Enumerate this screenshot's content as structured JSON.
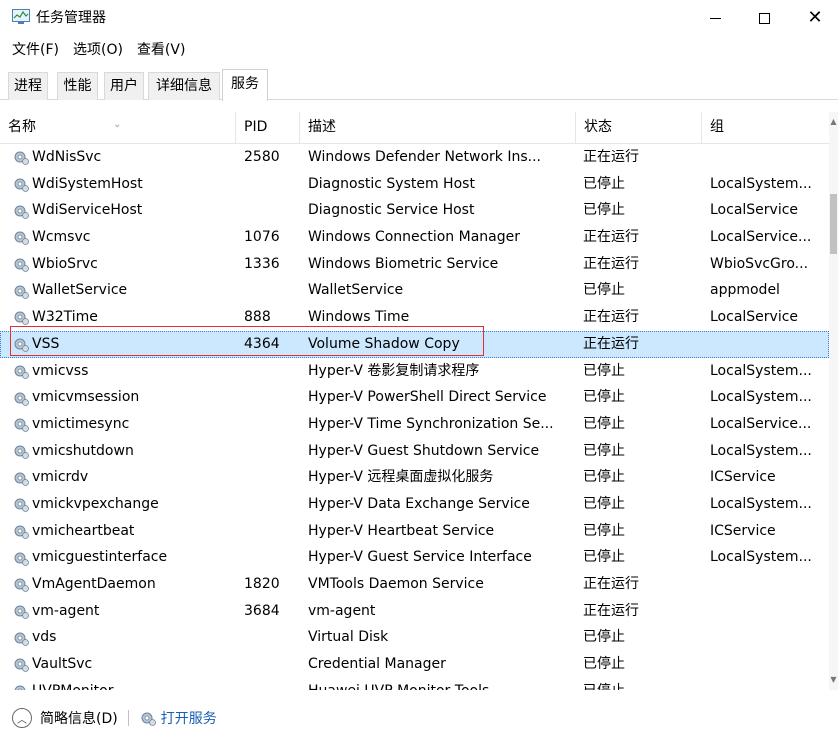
{
  "window": {
    "title": "任务管理器",
    "minimize_label": "—",
    "maximize_label": "☐",
    "close_label": "✕"
  },
  "menu": [
    "文件(F)",
    "选项(O)",
    "查看(V)"
  ],
  "tabs": [
    {
      "label": "进程",
      "active": false
    },
    {
      "label": "性能",
      "active": false
    },
    {
      "label": "用户",
      "active": false
    },
    {
      "label": "详细信息",
      "active": false
    },
    {
      "label": "服务",
      "active": true
    }
  ],
  "table": {
    "columns": {
      "name": "名称",
      "pid": "PID",
      "description": "描述",
      "status": "状态",
      "group": "组"
    },
    "sort_caret": "⌄",
    "rows": [
      {
        "name": "WdNisSvc",
        "pid": "2580",
        "description": "Windows Defender Network Ins...",
        "status": "正在运行",
        "group": ""
      },
      {
        "name": "WdiSystemHost",
        "pid": "",
        "description": "Diagnostic System Host",
        "status": "已停止",
        "group": "LocalSystem..."
      },
      {
        "name": "WdiServiceHost",
        "pid": "",
        "description": "Diagnostic Service Host",
        "status": "已停止",
        "group": "LocalService"
      },
      {
        "name": "Wcmsvc",
        "pid": "1076",
        "description": "Windows Connection Manager",
        "status": "正在运行",
        "group": "LocalService..."
      },
      {
        "name": "WbioSrvc",
        "pid": "1336",
        "description": "Windows Biometric Service",
        "status": "正在运行",
        "group": "WbioSvcGro..."
      },
      {
        "name": "WalletService",
        "pid": "",
        "description": "WalletService",
        "status": "已停止",
        "group": "appmodel"
      },
      {
        "name": "W32Time",
        "pid": "888",
        "description": "Windows Time",
        "status": "正在运行",
        "group": "LocalService"
      },
      {
        "name": "VSS",
        "pid": "4364",
        "description": "Volume Shadow Copy",
        "status": "正在运行",
        "group": "",
        "selected": true
      },
      {
        "name": "vmicvss",
        "pid": "",
        "description": "Hyper-V 卷影复制请求程序",
        "status": "已停止",
        "group": "LocalSystem..."
      },
      {
        "name": "vmicvmsession",
        "pid": "",
        "description": "Hyper-V PowerShell Direct Service",
        "status": "已停止",
        "group": "LocalSystem..."
      },
      {
        "name": "vmictimesync",
        "pid": "",
        "description": "Hyper-V Time Synchronization Se...",
        "status": "已停止",
        "group": "LocalService..."
      },
      {
        "name": "vmicshutdown",
        "pid": "",
        "description": "Hyper-V Guest Shutdown Service",
        "status": "已停止",
        "group": "LocalSystem..."
      },
      {
        "name": "vmicrdv",
        "pid": "",
        "description": "Hyper-V 远程桌面虚拟化服务",
        "status": "已停止",
        "group": "ICService"
      },
      {
        "name": "vmickvpexchange",
        "pid": "",
        "description": "Hyper-V Data Exchange Service",
        "status": "已停止",
        "group": "LocalSystem..."
      },
      {
        "name": "vmicheartbeat",
        "pid": "",
        "description": "Hyper-V Heartbeat Service",
        "status": "已停止",
        "group": "ICService"
      },
      {
        "name": "vmicguestinterface",
        "pid": "",
        "description": "Hyper-V Guest Service Interface",
        "status": "已停止",
        "group": "LocalSystem..."
      },
      {
        "name": "VmAgentDaemon",
        "pid": "1820",
        "description": "VMTools Daemon Service",
        "status": "正在运行",
        "group": ""
      },
      {
        "name": "vm-agent",
        "pid": "3684",
        "description": "vm-agent",
        "status": "正在运行",
        "group": ""
      },
      {
        "name": "vds",
        "pid": "",
        "description": "Virtual Disk",
        "status": "已停止",
        "group": ""
      },
      {
        "name": "VaultSvc",
        "pid": "",
        "description": "Credential Manager",
        "status": "已停止",
        "group": ""
      },
      {
        "name": "UVPMonitor",
        "pid": "",
        "description": "Huawei UVP Monitor Tools",
        "status": "已停止",
        "group": ""
      }
    ]
  },
  "scrollbar": {
    "up_arrow": "▲",
    "down_arrow": "▼"
  },
  "footer": {
    "fewer_details_icon": "︿",
    "fewer_details_label": "简略信息(D)",
    "open_services_label": "打开服务"
  },
  "colors": {
    "selection": "#cce8ff",
    "highlight_box": "#e03030",
    "link": "#1a5fb4"
  }
}
